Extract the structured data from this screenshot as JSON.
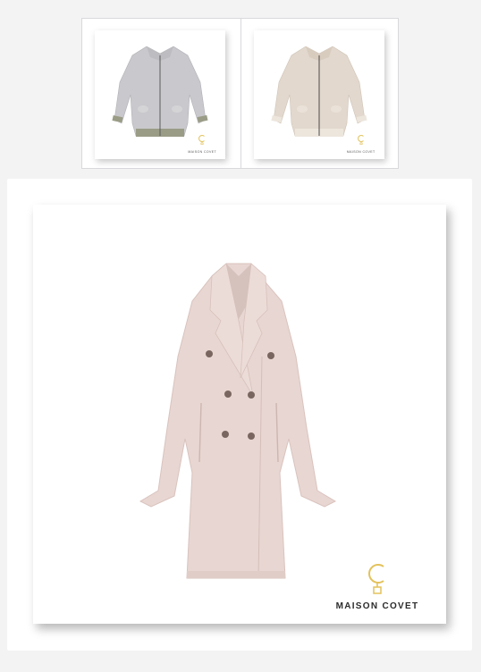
{
  "gallery": {
    "thumbnails": [
      {
        "name": "grey bomber jacket",
        "color": "#c9c8cc",
        "trim": "#9a9c86",
        "logo": "MAISON COVET"
      },
      {
        "name": "beige bomber jacket",
        "color": "#e2d8cd",
        "trim": "#ece6dd",
        "logo": "MAISON COVET"
      }
    ],
    "main_image": {
      "name": "pink double-breasted coat",
      "color": "#e8d6d2",
      "logo_text": "MAISON COVET",
      "accent": "#e3c25c"
    }
  }
}
